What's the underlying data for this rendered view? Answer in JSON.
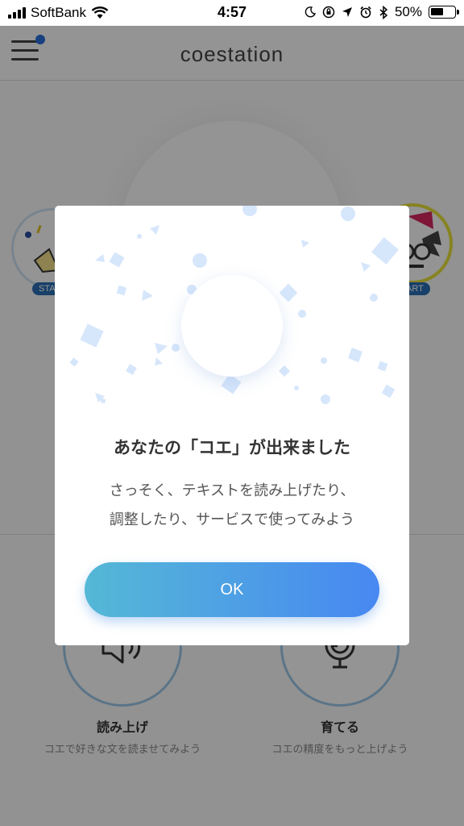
{
  "status_bar": {
    "carrier": "SoftBank",
    "time": "4:57",
    "battery": "50%",
    "icons": [
      "signal-bars-icon",
      "wifi-icon",
      "moon-icon",
      "rotation-lock-icon",
      "location-icon",
      "alarm-icon",
      "bluetooth-icon",
      "battery-icon"
    ]
  },
  "header": {
    "title": "coestation",
    "menu_icon": "hamburger-menu-icon",
    "notification_dot_color": "#2a6fdb"
  },
  "voice_cards": {
    "left_badge": "STA",
    "right_badge": "ART"
  },
  "features": [
    {
      "title": "読み上げ",
      "subtitle": "コエで好きな文を読ませてみよう",
      "icon": "speaker-icon"
    },
    {
      "title": "育てる",
      "subtitle": "コエの精度をもっと上げよう",
      "icon": "microphone-icon"
    }
  ],
  "modal": {
    "title": "あなたの「コエ」が出来ました",
    "body_line1": "さっそく、テキストを読み上げたり、",
    "body_line2": "調整したり、サービスで使ってみよう",
    "ok_label": "OK",
    "logo_icon": "voice-waveform-icon",
    "button_gradient": [
      "#55b8d6",
      "#4788f2"
    ]
  }
}
